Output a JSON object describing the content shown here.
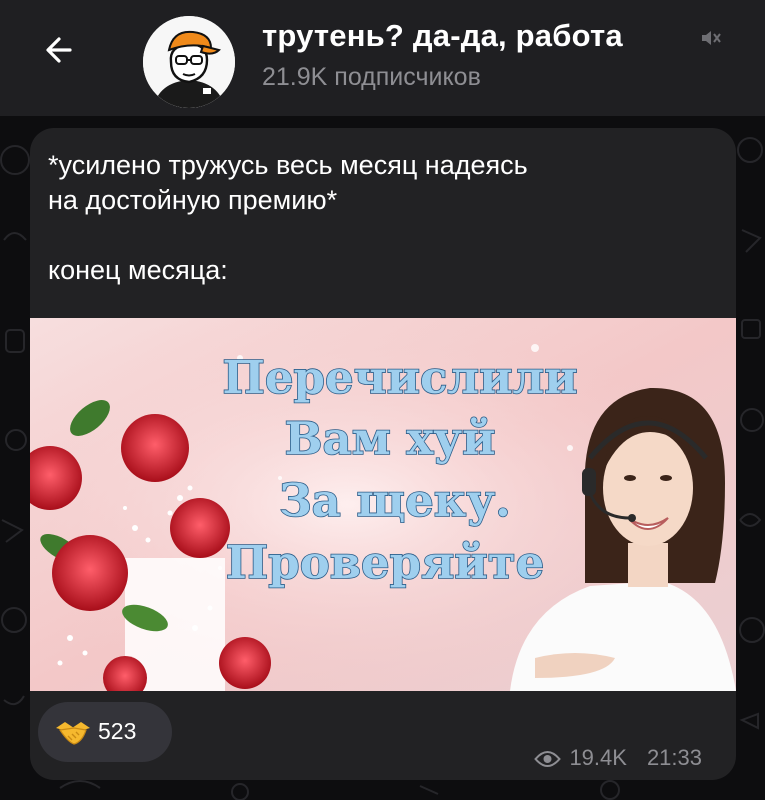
{
  "header": {
    "channel_title": "трутень? да-да, работа",
    "subscribers": "21.9K подписчиков",
    "back_icon": "arrow-left-icon",
    "mute_icon": "muted-speaker-icon"
  },
  "message": {
    "lines": [
      "*усилено тружусь весь месяц надеясь",
      "на достойную премию*",
      "конец месяца:"
    ],
    "media_text": [
      "Перечислили",
      "Вам хуй",
      "За щеку.",
      "Проверяйте"
    ],
    "reaction": {
      "emoji": "handshake",
      "count": "523"
    },
    "views": "19.4K",
    "time": "21:33"
  },
  "colors": {
    "header_bg": "#1f1f22",
    "bubble_bg": "#222224",
    "muted_text": "#8e8e93",
    "reaction_bg": "#34343a"
  }
}
